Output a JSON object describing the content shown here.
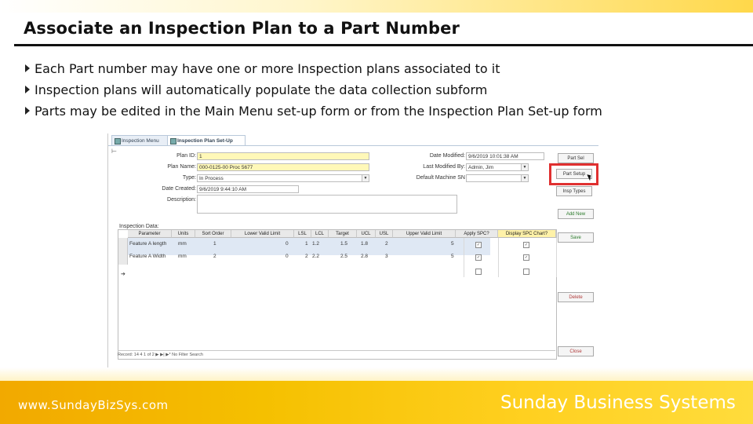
{
  "slide": {
    "title": "Associate an Inspection Plan to a Part Number",
    "bullets": [
      "Each Part number may have one or more Inspection plans associated to it",
      "Inspection plans will automatically populate the data collection subform",
      "Parts may be edited in the Main Menu set-up form or from the Inspection Plan Set-up form"
    ],
    "footer_url": "www.SundayBizSys.com",
    "footer_brand": "Sunday Business Systems"
  },
  "form": {
    "tabs": [
      "Inspection Menu",
      "Inspection Plan Set-Up"
    ],
    "fields": {
      "plan_id": {
        "label": "Plan ID:",
        "value": "1"
      },
      "plan_name": {
        "label": "Plan Name:",
        "value": "000-0125-00 Proc 5677"
      },
      "type": {
        "label": "Type:",
        "value": "In Process"
      },
      "date_created": {
        "label": "Date Created:",
        "value": "9/6/2019 9:44:10 AM"
      },
      "description": {
        "label": "Description:",
        "value": ""
      },
      "date_modified": {
        "label": "Date Modified:",
        "value": "9/6/2019 10:01:38 AM"
      },
      "last_modified_by": {
        "label": "Last Modified By:",
        "value": "Admin, Jim"
      },
      "default_machine": {
        "label": "Default Machine SN",
        "value": ""
      }
    },
    "buttons": {
      "part_sel": "Part Sel",
      "part_setup": "Part Setup",
      "insp_types": "Insp Types",
      "add_new": "Add New",
      "save": "Save",
      "delete": "Delete",
      "close": "Close"
    },
    "subform": {
      "label": "Inspection Data:",
      "columns": [
        "Parameter",
        "Units",
        "Sort Order",
        "Lower Valid Limit",
        "LSL",
        "LCL",
        "Target",
        "UCL",
        "USL",
        "Upper Valid Limit",
        "Apply SPC?",
        "Display SPC Chart?"
      ],
      "rows": [
        [
          "Feature A length",
          "mm",
          "1",
          "0",
          "1",
          "1.2",
          "1.5",
          "1.8",
          "2",
          "5",
          "checked",
          "checked"
        ],
        [
          "Feature A Width",
          "mm",
          "2",
          "0",
          "2",
          "2.2",
          "2.5",
          "2.8",
          "3",
          "5",
          "checked",
          "checked"
        ]
      ],
      "record_nav": "Record: 14 4  1 of 2  ▶ ▶| ▶*   No Filter   Search"
    }
  },
  "colors": {
    "accent": "#ffd020",
    "highlight": "#e03030"
  },
  "icons": [
    "arrow-bullet-icon",
    "form-tab-icon",
    "mouse-cursor-icon",
    "checkbox-icon",
    "new-record-icon"
  ]
}
